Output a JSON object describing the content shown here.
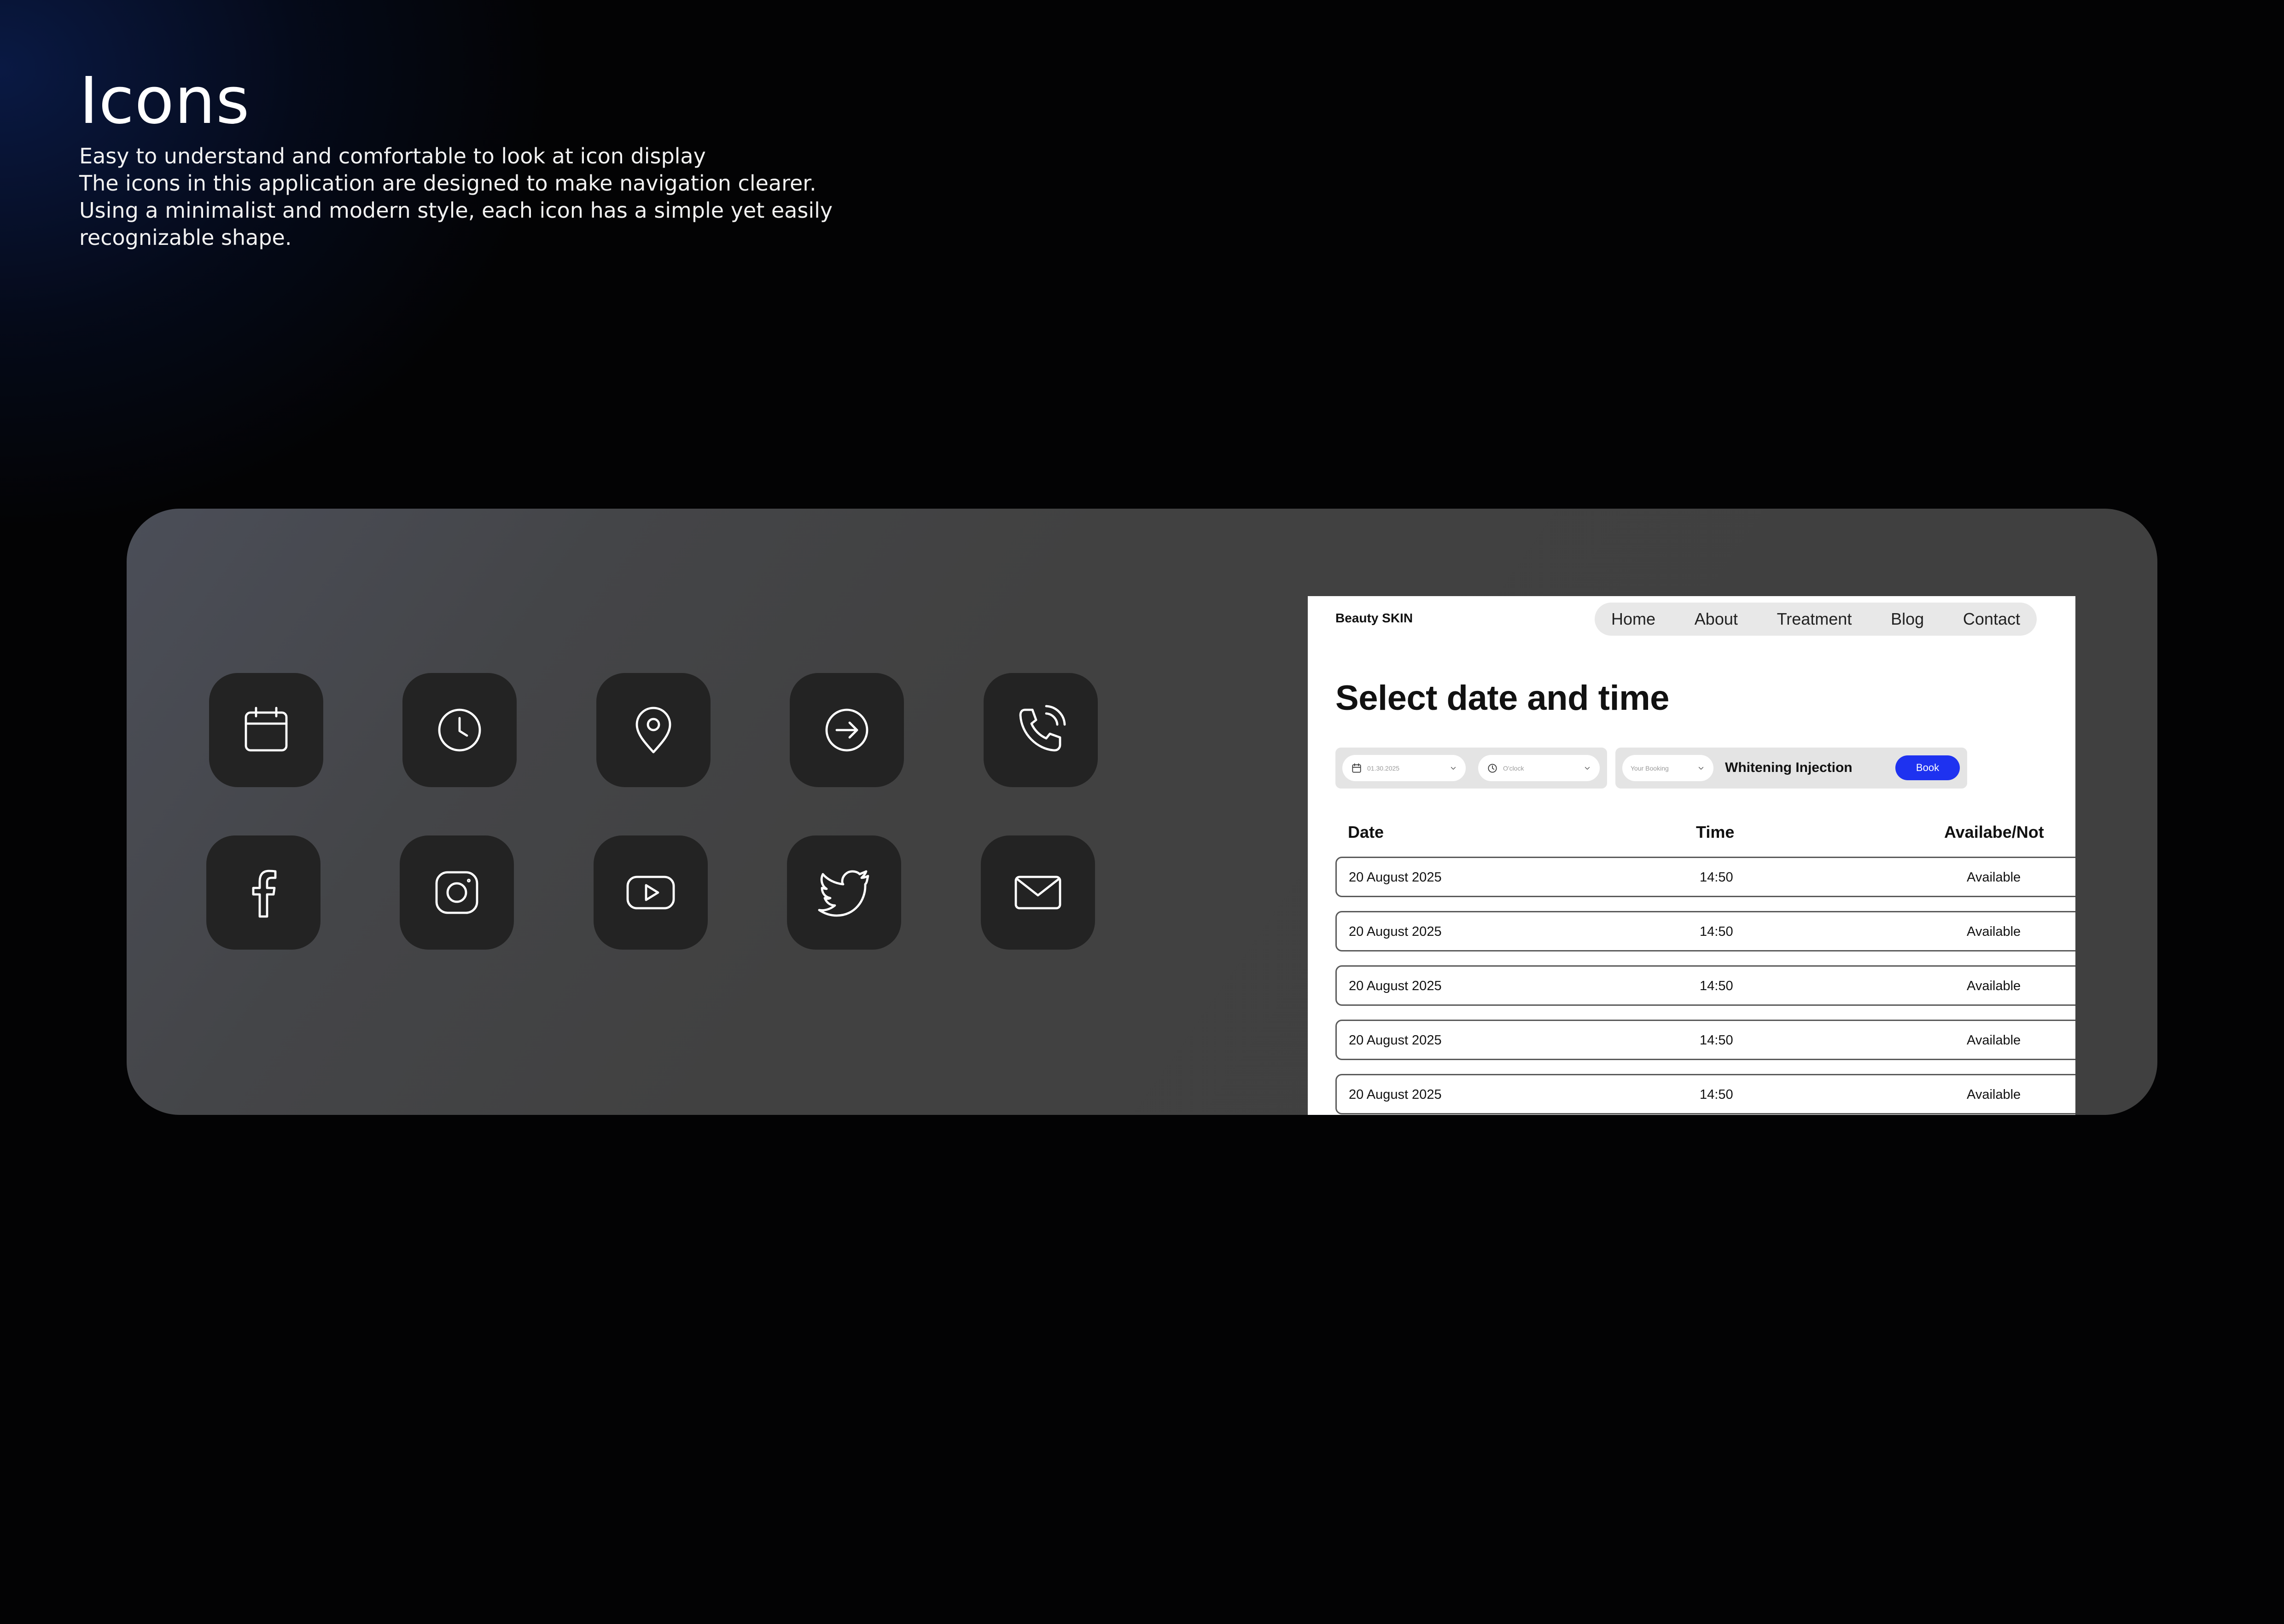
{
  "intro": {
    "title": "Icons",
    "lines": [
      "Easy to understand and comfortable to look at icon display",
      "The icons in this application are designed to make navigation clearer.",
      "Using a minimalist and modern style, each icon has a simple yet easily",
      "recognizable shape."
    ]
  },
  "icon_grid": {
    "row1": [
      "calendar-icon",
      "clock-icon",
      "location-pin-icon",
      "arrow-right-circle-icon",
      "phone-call-icon"
    ],
    "row2": [
      "facebook-icon",
      "instagram-icon",
      "youtube-icon",
      "twitter-icon",
      "mail-icon"
    ]
  },
  "mockup": {
    "brand": "Beauty SKIN",
    "nav": [
      "Home",
      "About",
      "Treatment",
      "Blog",
      "Contact"
    ],
    "heading": "Select date and time",
    "filters": {
      "date_value": "01.30.2025",
      "time_placeholder": "O'clock",
      "booking_placeholder": "Your Booking",
      "treatment": "Whitening Injection",
      "book_label": "Book"
    },
    "table": {
      "headers": [
        "Date",
        "Time",
        "Availabe/Not"
      ],
      "rows": [
        [
          "20 August 2025",
          "14:50",
          "Available"
        ],
        [
          "20 August 2025",
          "14:50",
          "Available"
        ],
        [
          "20 August 2025",
          "14:50",
          "Available"
        ],
        [
          "20 August 2025",
          "14:50",
          "Available"
        ],
        [
          "20 August 2025",
          "14:50",
          "Available"
        ]
      ]
    },
    "colors": {
      "accent": "#1e32f0"
    }
  }
}
